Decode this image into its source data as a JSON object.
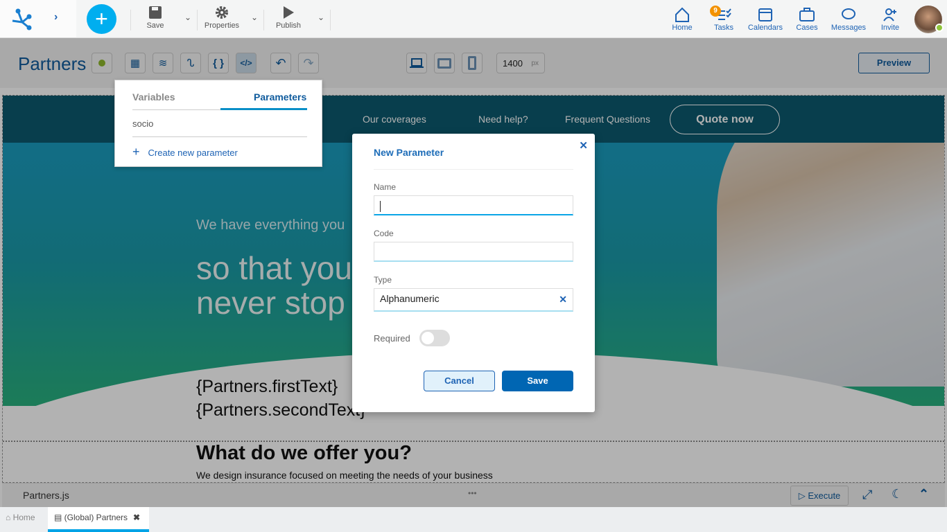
{
  "topbar": {
    "save": "Save",
    "properties": "Properties",
    "publish": "Publish",
    "right": [
      {
        "label": "Home",
        "icon": "home-icon"
      },
      {
        "label": "Tasks",
        "icon": "tasks-icon",
        "badge": "9"
      },
      {
        "label": "Calendars",
        "icon": "calendar-icon"
      },
      {
        "label": "Cases",
        "icon": "briefcase-icon"
      },
      {
        "label": "Messages",
        "icon": "message-icon"
      },
      {
        "label": "Invite",
        "icon": "invite-icon"
      }
    ]
  },
  "editor": {
    "title": "Partners",
    "width_value": "1400",
    "width_unit": "px",
    "preview": "Preview"
  },
  "popover": {
    "tabs": [
      "Variables",
      "Parameters"
    ],
    "active_tab": "Parameters",
    "items": [
      "socio"
    ],
    "create": "Create new parameter"
  },
  "page": {
    "nav": [
      "Our coverages",
      "Need help?",
      "Frequent Questions"
    ],
    "quote": "Quote now",
    "subtitle": "We have everything you",
    "headline1": "so that you",
    "headline2": "never stop",
    "text1": "{Partners.firstText}",
    "text2": "{Partners.secondText}",
    "section_title": "What do we offer you?",
    "section_text": "We design insurance focused on meeting the needs of your business"
  },
  "dialog": {
    "title": "New Parameter",
    "name_label": "Name",
    "name_value": "",
    "code_label": "Code",
    "code_value": "",
    "type_label": "Type",
    "type_value": "Alphanumeric",
    "required_label": "Required",
    "required": false,
    "cancel": "Cancel",
    "save": "Save"
  },
  "bottom": {
    "file": "Partners.js",
    "execute": "Execute"
  },
  "tabs": [
    {
      "label": "Home"
    },
    {
      "label": "(Global) Partners",
      "active": true
    }
  ],
  "colors": {
    "accent": "#0066b3",
    "brand": "#00aeef",
    "status": "#8fb82b"
  }
}
